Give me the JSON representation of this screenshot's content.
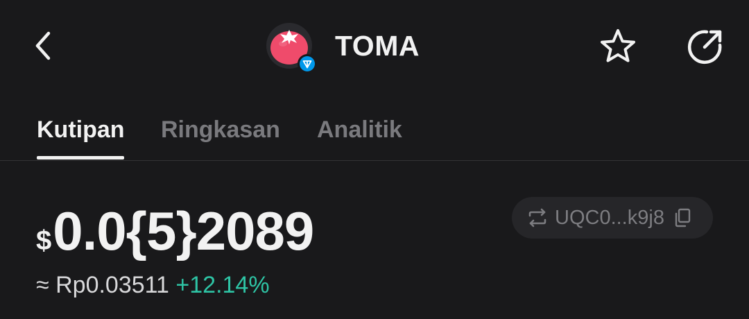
{
  "header": {
    "back_icon": "chevron-left-icon",
    "token_symbol": "TOMA",
    "logo_icon": "tomato-logo-icon",
    "chain_badge_icon": "ton-badge-icon",
    "favorite_icon": "star-outline-icon",
    "share_icon": "share-arrow-icon"
  },
  "tabs": [
    {
      "label": "Kutipan",
      "active": true
    },
    {
      "label": "Ringkasan",
      "active": false
    },
    {
      "label": "Analitik",
      "active": false
    }
  ],
  "price": {
    "currency_symbol": "$",
    "value": "0.0{5}2089",
    "approx_local": "≈ Rp0.03511",
    "change": "+12.14%"
  },
  "contract": {
    "address": "UQC0...k9j8",
    "swap_icon": "swap-icon",
    "copy_icon": "copy-icon"
  },
  "colors": {
    "background": "#19191b",
    "text_primary": "#f2f2f2",
    "text_muted": "#7a7a7e",
    "positive": "#2ec4a5",
    "logo_red": "#ef4b6b",
    "ton_blue": "#0098ea"
  }
}
